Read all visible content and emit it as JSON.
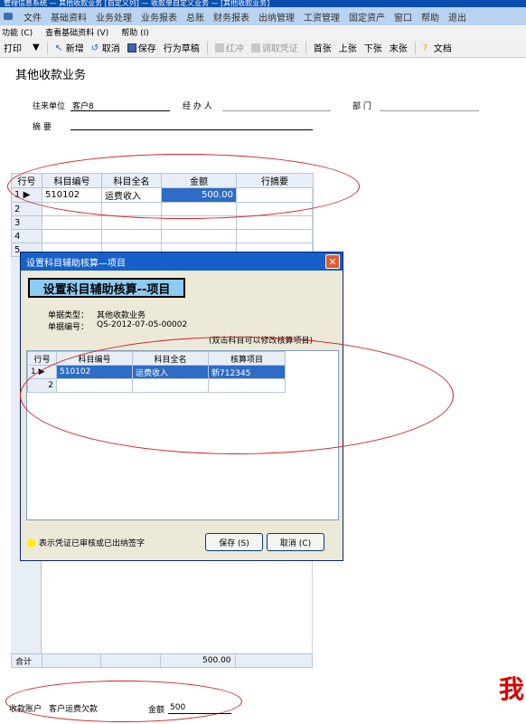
{
  "window": {
    "title": "管理信息系统 — 其他收款业务 [自定义列] — 收款单自定义业务 — [其他收款业务]"
  },
  "menu": [
    "文件",
    "基础资料",
    "业务处理",
    "业务报表",
    "总账",
    "财务报表",
    "出纳管理",
    "工资管理",
    "固定资产",
    "窗口",
    "帮助",
    "退出"
  ],
  "submenu": [
    "功能 (C)",
    "查看基础资料 (V)",
    "帮助 (I)"
  ],
  "toolbar": {
    "print": "打印",
    "new": "新增",
    "cancel": "取消",
    "save": "保存",
    "save_draft": "行为草稿",
    "red": "红冲",
    "unapprove": "调取凭证",
    "first": "首张",
    "prev": "上张",
    "next": "下张",
    "last": "末张",
    "text_right": "文档"
  },
  "form": {
    "title": "其他收款业务",
    "unit_label": "往来单位",
    "unit_value": "客户8",
    "handler_label": "经 办 人",
    "dept_label": "部 门",
    "summary_label": "摘 要"
  },
  "grid": {
    "headers": [
      "行号",
      "科目编号",
      "科目全名",
      "金额",
      "行摘要"
    ],
    "rows": [
      {
        "no": "1",
        "code": "510102",
        "name": "运费收入",
        "amount": "500.00",
        "memo": ""
      },
      {
        "no": "2",
        "code": "",
        "name": "",
        "amount": "",
        "memo": ""
      },
      {
        "no": "3",
        "code": "",
        "name": "",
        "amount": "",
        "memo": ""
      },
      {
        "no": "4",
        "code": "",
        "name": "",
        "amount": "",
        "memo": ""
      },
      {
        "no": "5",
        "code": "",
        "name": "",
        "amount": "",
        "memo": ""
      }
    ],
    "total_label": "合计",
    "total_amount": "500.00"
  },
  "dialog": {
    "title": "设置科目辅助核算—项目",
    "banner": "设置科目辅助核算--项目",
    "doc_type_label": "单据类型：",
    "doc_type_value": "其他收款业务",
    "doc_no_label": "单据编号：",
    "doc_no_value": "QS-2012-07-05-00002",
    "hint": "(双击科目可以修改核算项目)",
    "headers": [
      "行号",
      "科目编号",
      "科目全名",
      "核算项目"
    ],
    "rows": [
      {
        "no": "1",
        "code": "510102",
        "name": "运费收入",
        "item": "新712345"
      },
      {
        "no": "2",
        "code": "",
        "name": "",
        "item": ""
      }
    ],
    "legend": "表示凭证已审核或已出纳签字",
    "save_btn": "保存 (S)",
    "cancel_btn": "取消 (C)"
  },
  "footer": {
    "account_label": "收款账户",
    "account_value": "客户运费欠款",
    "amount_label": "金额",
    "amount_value": "500",
    "big_char": "我"
  },
  "colors": {
    "annotation": "#d12020",
    "titlebar": "#0b4fae",
    "selection": "#2e6cc5"
  }
}
